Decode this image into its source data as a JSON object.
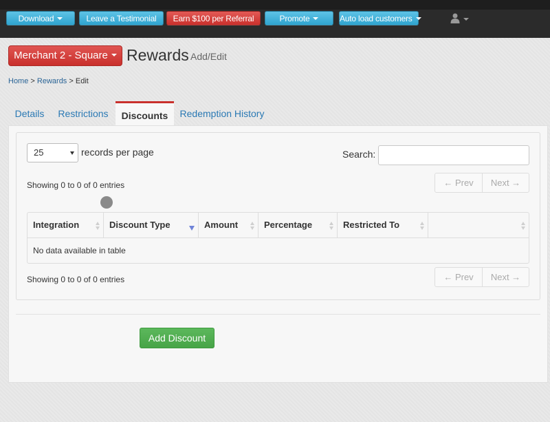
{
  "top_nav": {
    "download": "Download",
    "testimonial": "Leave a Testimonial",
    "referral": "Earn $100 per Referral",
    "promote": "Promote",
    "auto_load": "Auto load customers"
  },
  "header": {
    "merchant_label": "Merchant 2 - Square",
    "title": "Rewards",
    "subtitle": "Add/Edit"
  },
  "breadcrumb": {
    "home": "Home",
    "sep": ">",
    "rewards": "Rewards",
    "current": "Edit"
  },
  "tabs": [
    {
      "label": "Details"
    },
    {
      "label": "Restrictions"
    },
    {
      "label": "Discounts",
      "active": true
    },
    {
      "label": "Redemption History"
    }
  ],
  "table_controls": {
    "page_size": "25",
    "records_per_page": "records per page",
    "search_label": "Search:",
    "search_value": "",
    "info_top": "Showing 0 to 0 of 0 entries",
    "info_bottom": "Showing 0 to 0 of 0 entries",
    "prev": "← Prev",
    "next": "Next →"
  },
  "table": {
    "columns": [
      "Integration",
      "Discount Type",
      "Amount",
      "Percentage",
      "Restricted To",
      ""
    ],
    "sorted_column": "Discount Type",
    "sort_direction": "desc",
    "empty_message": "No data available in table"
  },
  "actions": {
    "add_discount": "Add Discount"
  },
  "colors": {
    "nav_bg": "#2b2b2b",
    "nav_blue": "#2fa4cf",
    "danger": "#c9302c",
    "success": "#5cb85c",
    "link": "#2a79b4"
  }
}
